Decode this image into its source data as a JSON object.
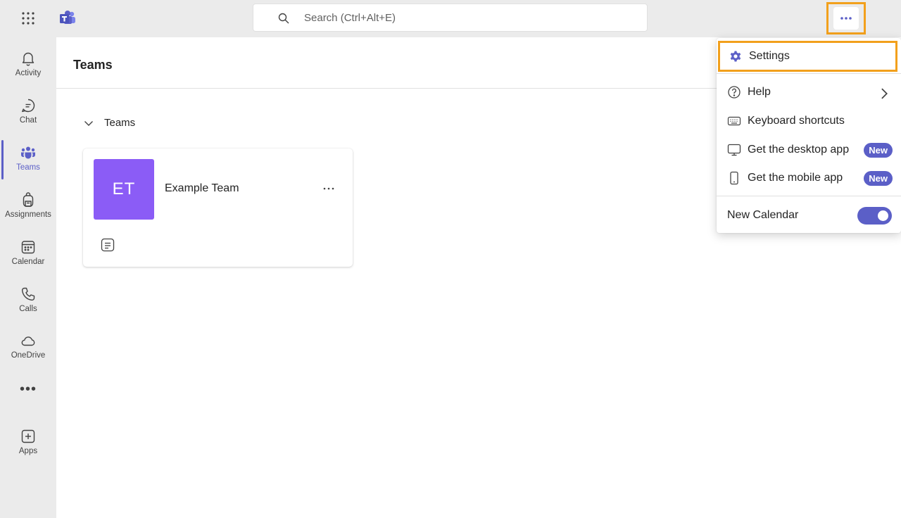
{
  "topbar": {
    "search_placeholder": "Search (Ctrl+Alt+E)",
    "waffle_icon": "app-launcher-icon",
    "logo_icon": "teams-logo-icon",
    "more_icon": "more-options-icon",
    "more_label": "•••"
  },
  "rail": {
    "items": [
      {
        "label": "Activity",
        "icon": "bell-icon"
      },
      {
        "label": "Chat",
        "icon": "chat-icon"
      },
      {
        "label": "Teams",
        "icon": "teams-icon",
        "active": true
      },
      {
        "label": "Assignments",
        "icon": "backpack-icon"
      },
      {
        "label": "Calendar",
        "icon": "calendar-icon"
      },
      {
        "label": "Calls",
        "icon": "phone-icon"
      },
      {
        "label": "OneDrive",
        "icon": "cloud-icon"
      },
      {
        "label": "Apps",
        "icon": "add-app-icon"
      }
    ],
    "more_label": "•••"
  },
  "main": {
    "title": "Teams",
    "section_label": "Teams",
    "team_card": {
      "initials": "ET",
      "name": "Example Team",
      "more_label": "···",
      "avatar_color": "#8b5cf6"
    }
  },
  "menu": {
    "settings": "Settings",
    "help": "Help",
    "keyboard_shortcuts": "Keyboard shortcuts",
    "desktop_app": "Get the desktop app",
    "mobile_app": "Get the mobile app",
    "new_badge": "New",
    "new_calendar": "New Calendar",
    "new_calendar_on": true
  },
  "colors": {
    "accent": "#5b5fc7",
    "highlight": "#f2a01c"
  }
}
